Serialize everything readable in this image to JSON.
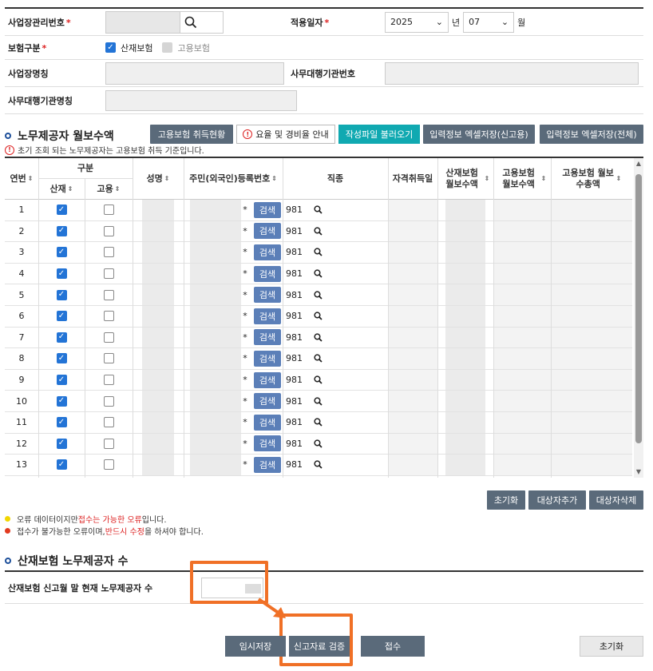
{
  "form": {
    "biz_no_label": "사업장관리번호",
    "apply_date_label": "적용일자",
    "year": "2025",
    "year_unit": "년",
    "month": "07",
    "month_unit": "월",
    "insurance_type_label": "보험구분",
    "opt_industrial": "산재보험",
    "opt_employment": "고용보험",
    "biz_name_label": "사업장명칭",
    "agency_no_label": "사무대행기관번호",
    "agency_name_label": "사무대행기관명칭"
  },
  "section1": {
    "title": "노무제공자 월보수액",
    "btn_status": "고용보험 취득현황",
    "btn_rate": "요율 및 경비율 안내",
    "btn_load": "작성파일 불러오기",
    "btn_excel_report": "입력정보 엑셀저장(신고용)",
    "btn_excel_all": "입력정보 엑셀저장(전체)",
    "notice": "초기 조회 되는 노무제공자는 고용보험 취득 기준입니다."
  },
  "grid": {
    "headers": {
      "seq": "연번",
      "type": "구분",
      "industrial": "산재",
      "employment": "고용",
      "name": "성명",
      "rrn": "주민(외국인)등록번호",
      "job": "직종",
      "acq_date": "자격취득일",
      "ind_monthly": "산재보험 월보수액",
      "emp_monthly": "고용보험 월보수액",
      "emp_total": "고용보험 월보수총액"
    },
    "search_label": "검색",
    "job_code": "981",
    "rows": [
      "1",
      "2",
      "3",
      "4",
      "5",
      "6",
      "7",
      "8",
      "9",
      "10",
      "11",
      "12",
      "13"
    ]
  },
  "actions": {
    "reset": "초기화",
    "add": "대상자추가",
    "delete": "대상자삭제"
  },
  "legend": {
    "l1_a": "오류 데이터이지만 ",
    "l1_b": "접수는 가능한 오류",
    "l1_c": "입니다.",
    "l2_a": "접수가 불가능한 오류이며, ",
    "l2_b": "반드시 수정",
    "l2_c": "을 하셔야 합니다."
  },
  "section2": {
    "title": "산재보험 노무제공자 수",
    "count_label": "산재보험 신고월 말 현재 노무제공자 수"
  },
  "bottom": {
    "temp_save": "임시저장",
    "verify": "신고자료 검증",
    "submit": "접수",
    "reset": "초기화"
  },
  "colors": {
    "accent_dark": "#5a6a7a",
    "teal": "#10a9b1",
    "search_btn": "#5b7fb8",
    "checkbox": "#2374d6",
    "highlight": "#f07026"
  }
}
